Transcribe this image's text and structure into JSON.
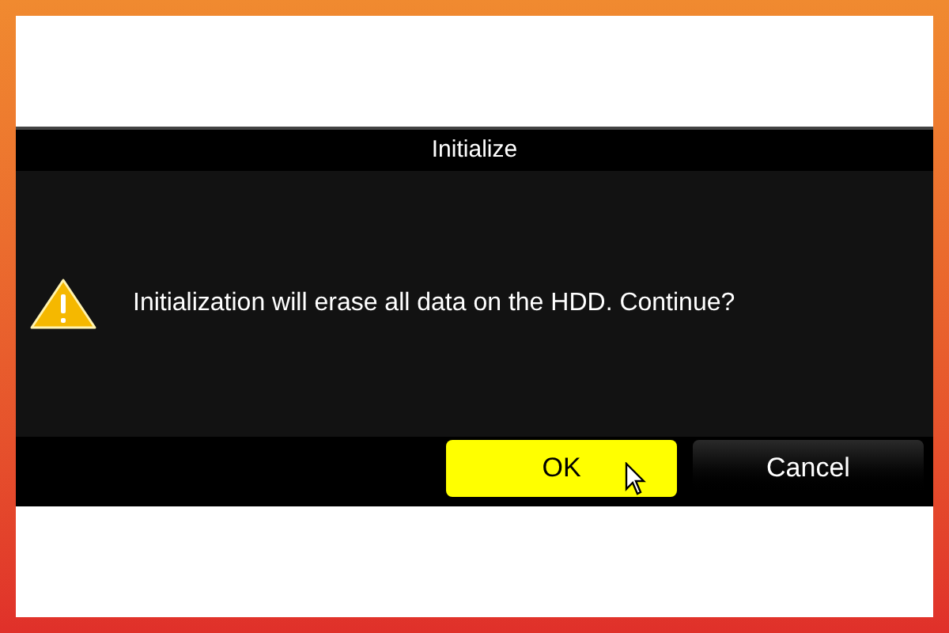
{
  "dialog": {
    "title": "Initialize",
    "message": "Initialization will erase all data on the HDD. Continue?"
  },
  "buttons": [
    {
      "label": "OK",
      "selected": true
    },
    {
      "label": "Cancel",
      "selected": false
    }
  ]
}
